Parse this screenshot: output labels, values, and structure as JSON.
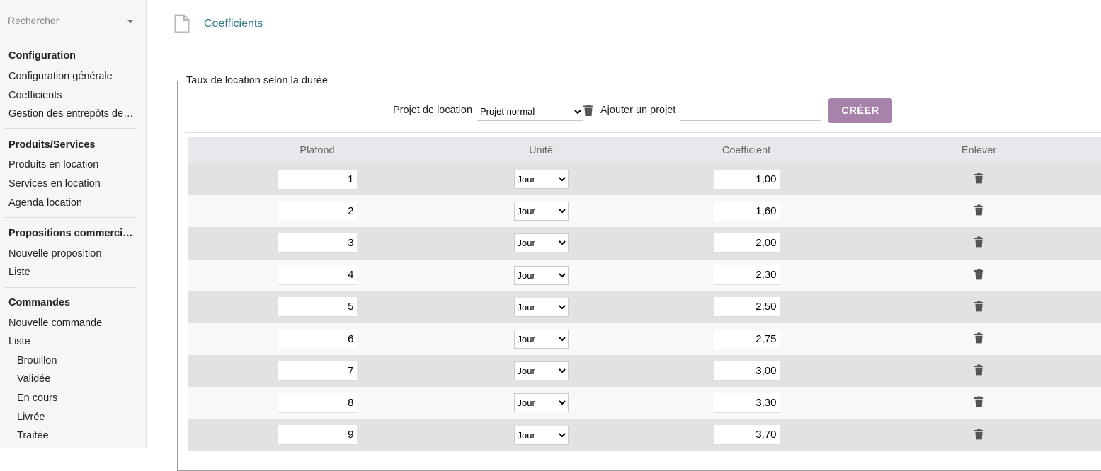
{
  "sidebar": {
    "search_placeholder": "Rechercher",
    "sections": [
      {
        "title": "Configuration",
        "items": [
          "Configuration générale",
          "Coefficients",
          "Gestion des entrepôts de…"
        ]
      },
      {
        "title": "Produits/Services",
        "items": [
          "Produits en location",
          "Services en location",
          "Agenda location"
        ]
      },
      {
        "title": "Propositions commerci…",
        "items": [
          "Nouvelle proposition",
          "Liste"
        ]
      },
      {
        "title": "Commandes",
        "items": [
          "Nouvelle commande",
          "Liste"
        ],
        "subitems": [
          "Brouillon",
          "Validée",
          "En cours",
          "Livrée",
          "Traitée"
        ]
      }
    ]
  },
  "main": {
    "page_title": "Coefficients",
    "fieldset_legend": "Taux de location selon la durée",
    "project_label": "Projet de location",
    "project_selected": "Projet normal",
    "add_project_label": "Ajouter un projet",
    "add_project_value": "",
    "create_button": "CRÉER",
    "table": {
      "headers": [
        "Plafond",
        "Unité",
        "Coefficient",
        "Enlever"
      ],
      "rows": [
        {
          "plafond": "1",
          "unite": "Jour",
          "coefficient": "1,00"
        },
        {
          "plafond": "2",
          "unite": "Jour",
          "coefficient": "1,60"
        },
        {
          "plafond": "3",
          "unite": "Jour",
          "coefficient": "2,00"
        },
        {
          "plafond": "4",
          "unite": "Jour",
          "coefficient": "2,30"
        },
        {
          "plafond": "5",
          "unite": "Jour",
          "coefficient": "2,50"
        },
        {
          "plafond": "6",
          "unite": "Jour",
          "coefficient": "2,75"
        },
        {
          "plafond": "7",
          "unite": "Jour",
          "coefficient": "3,00"
        },
        {
          "plafond": "8",
          "unite": "Jour",
          "coefficient": "3,30"
        },
        {
          "plafond": "9",
          "unite": "Jour",
          "coefficient": "3,70"
        }
      ]
    }
  },
  "colors": {
    "accent_button": "#a782ab",
    "title_link": "#2a7c80",
    "row_odd": "#e2e2e2",
    "row_even": "#f8f8f8"
  },
  "icons": [
    "file-icon",
    "trash-icon",
    "chevron-down-icon"
  ]
}
